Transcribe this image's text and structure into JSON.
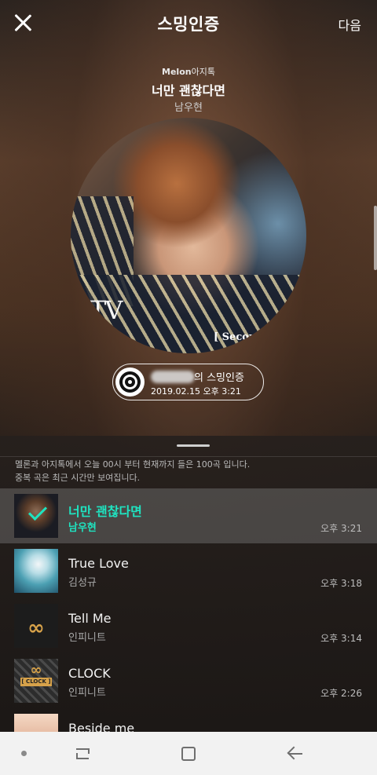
{
  "header": {
    "title": "스밍인증",
    "next_label": "다음"
  },
  "track": {
    "brand_melon": "Melon",
    "brand_ajitalk": "아지톡",
    "title": "너만 괜찮다면",
    "artist": "남우현"
  },
  "album": {
    "mark": "TV",
    "caption": "[ Second"
  },
  "badge": {
    "label": "의 스밍인증",
    "date": "2019.02.15 오후 3:21"
  },
  "notice": {
    "line1": "멜론과 아지톡에서 오늘 00시 부터 현재까지 들은 100곡 입니다.",
    "line2": "중복 곡은 최근 시간만 보여집니다."
  },
  "songs": [
    {
      "title": "너만 괜찮다면",
      "artist": "남우현",
      "time": "오후 3:21",
      "selected": true
    },
    {
      "title": "True Love",
      "artist": "김성규",
      "time": "오후 3:18"
    },
    {
      "title": "Tell Me",
      "artist": "인피니트",
      "time": "오후 3:14"
    },
    {
      "title": "CLOCK",
      "artist": "인피니트",
      "time": "오후 2:26",
      "album_tag": "[ CLOCK ]"
    },
    {
      "title": "Beside me",
      "artist": "",
      "time": ""
    }
  ],
  "colors": {
    "accent": "#1fe3c0",
    "nav_background": "#f2f2f2"
  },
  "icons": {
    "close": "close-icon",
    "disc": "disc-icon",
    "check": "check-icon",
    "nav_recent": "recent-apps-icon",
    "nav_home": "home-icon",
    "nav_back": "back-arrow-icon"
  }
}
